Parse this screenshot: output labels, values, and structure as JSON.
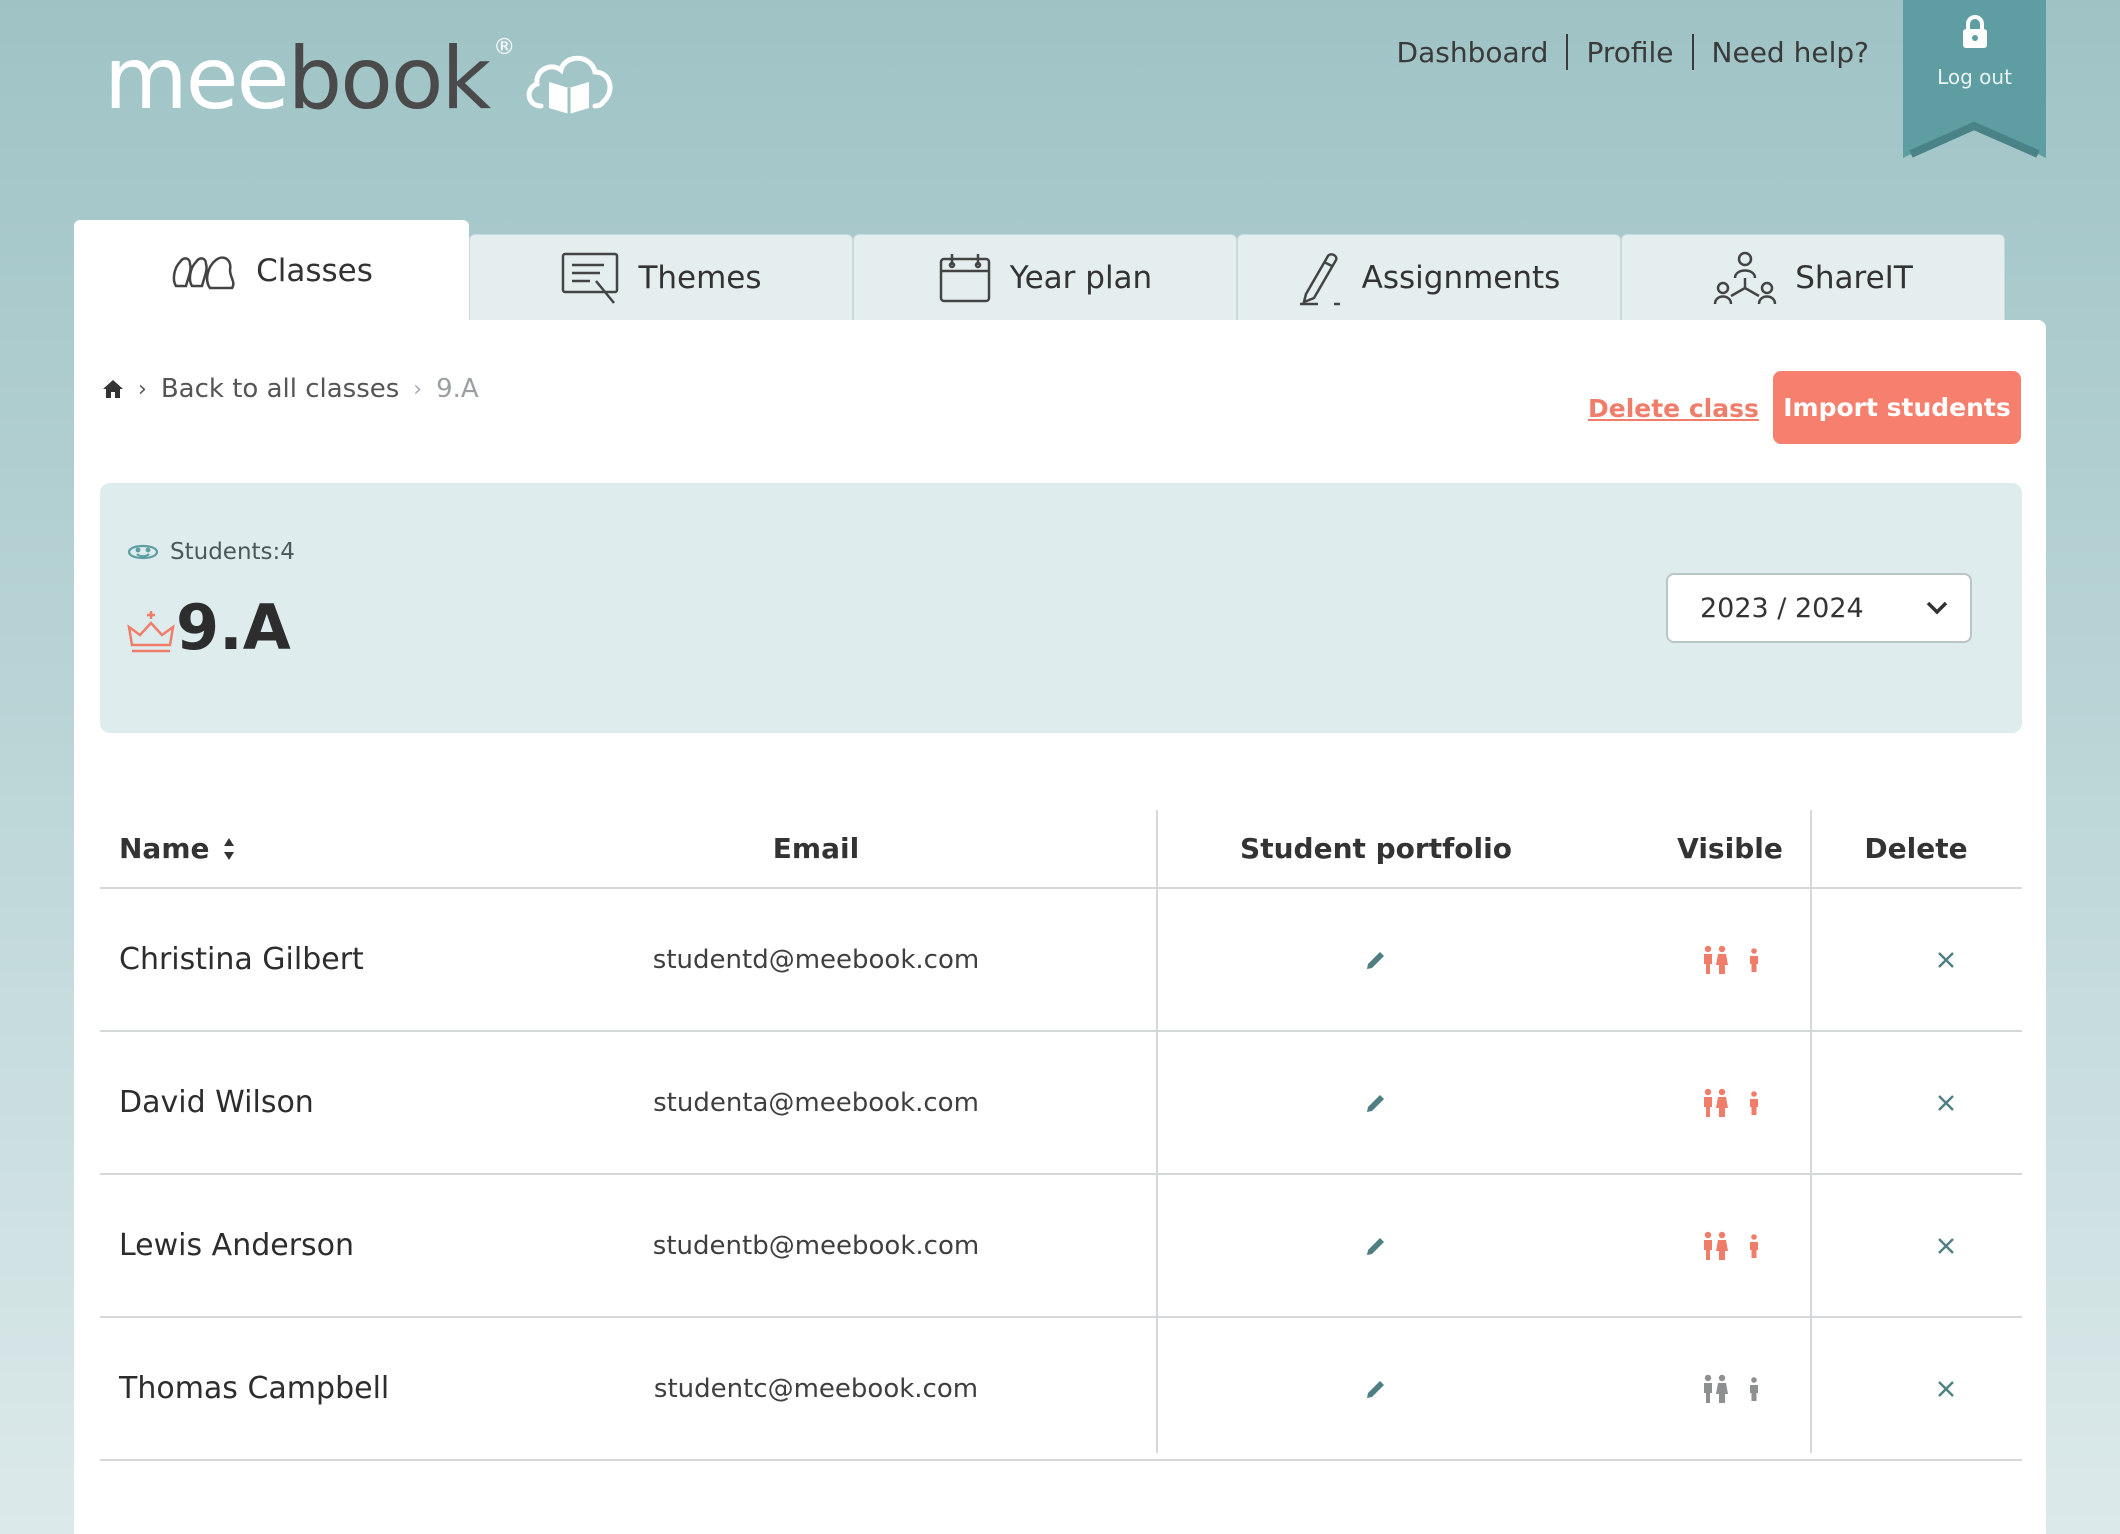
{
  "brand": {
    "logo_part1": "mee",
    "logo_part2": "book",
    "registered": "®"
  },
  "topnav": [
    {
      "label": "Dashboard"
    },
    {
      "label": "Profile"
    },
    {
      "label": "Need help?"
    }
  ],
  "logout": {
    "label": "Log out"
  },
  "tabs": [
    {
      "label": "Classes",
      "icon": "classes-icon",
      "active": true
    },
    {
      "label": "Themes",
      "icon": "themes-icon"
    },
    {
      "label": "Year plan",
      "icon": "calendar-icon"
    },
    {
      "label": "Assignments",
      "icon": "pencil-icon"
    },
    {
      "label": "ShareIT",
      "icon": "share-network-icon"
    }
  ],
  "breadcrumb": {
    "back": "Back to all classes",
    "current": "9.A"
  },
  "actions": {
    "delete_class": "Delete class",
    "import_students": "Import students"
  },
  "class_info": {
    "students_label": "Students:4",
    "name": "9.A",
    "year": "2023 / 2024"
  },
  "table": {
    "headers": {
      "name": "Name",
      "email": "Email",
      "portfolio": "Student portfolio",
      "visible": "Visible",
      "delete": "Delete"
    },
    "rows": [
      {
        "name": "Christina Gilbert",
        "email": "studentd@meebook.com",
        "visible": true
      },
      {
        "name": "David Wilson",
        "email": "studenta@meebook.com",
        "visible": true
      },
      {
        "name": "Lewis Anderson",
        "email": "studentb@meebook.com",
        "visible": true
      },
      {
        "name": "Thomas Campbell",
        "email": "studentc@meebook.com",
        "visible": false
      }
    ]
  },
  "colors": {
    "accent": "#f6806d",
    "teal": "#5e9ea2",
    "hidden_grey": "#8c9090"
  }
}
